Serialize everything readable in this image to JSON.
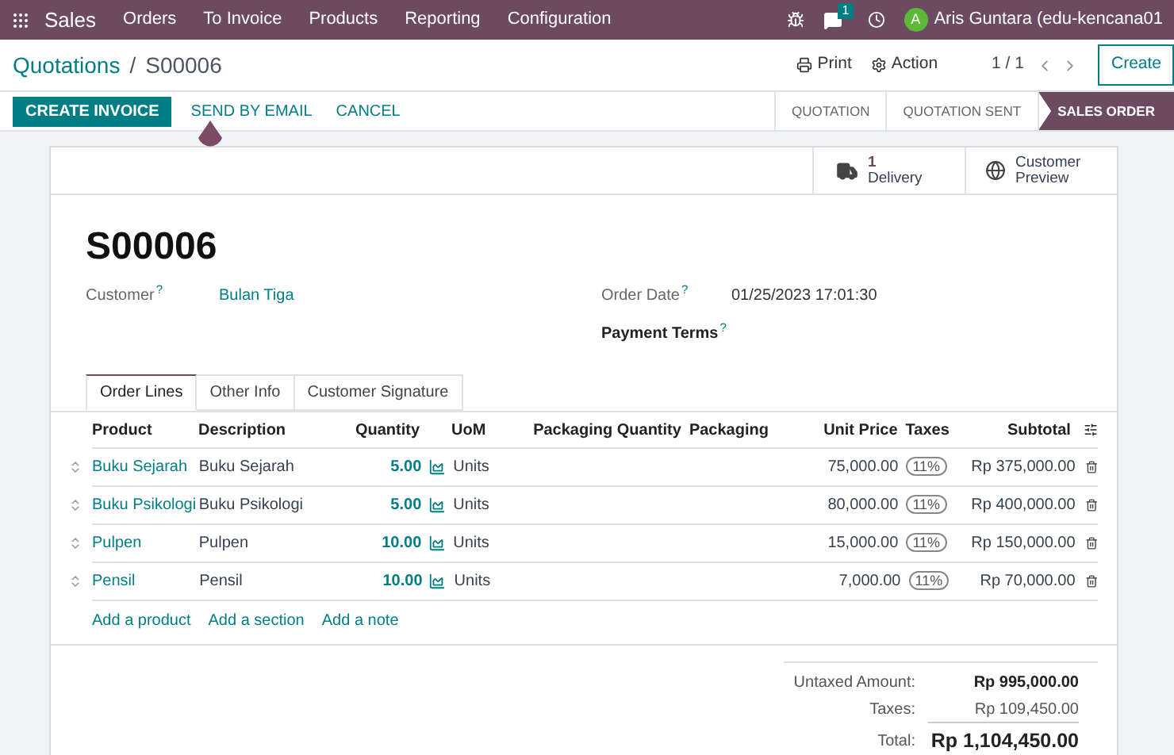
{
  "navbar": {
    "app": "Sales",
    "menu": [
      "Orders",
      "To Invoice",
      "Products",
      "Reporting",
      "Configuration"
    ],
    "messages_badge": "1",
    "user_initial": "A",
    "user_name": "Aris Guntara (edu-kencana01"
  },
  "breadcrumb": {
    "parent": "Quotations",
    "separator": "/",
    "current": "S00006"
  },
  "toolbar": {
    "print": "Print",
    "action": "Action",
    "pager": "1 / 1",
    "create": "Create"
  },
  "actions": [
    {
      "label": "CREATE INVOICE",
      "kind": "primary"
    },
    {
      "label": "SEND BY EMAIL",
      "kind": "link"
    },
    {
      "label": "CANCEL",
      "kind": "link"
    }
  ],
  "stages": [
    {
      "label": "QUOTATION",
      "selected": false
    },
    {
      "label": "QUOTATION SENT",
      "selected": false
    },
    {
      "label": "SALES ORDER",
      "selected": true
    }
  ],
  "smart_buttons": [
    {
      "kind": "delivery",
      "count": "1",
      "label": "Delivery"
    },
    {
      "kind": "preview",
      "line1": "Customer",
      "line2": "Preview"
    }
  ],
  "record": {
    "name": "S00006",
    "customer_label": "Customer",
    "customer": "Bulan Tiga",
    "order_date_label": "Order Date",
    "order_date": "01/25/2023 17:01:30",
    "payment_terms_label": "Payment Terms",
    "help_mark": "?"
  },
  "tabs": [
    {
      "label": "Order Lines",
      "selected": true
    },
    {
      "label": "Other Info",
      "selected": false
    },
    {
      "label": "Customer Signature",
      "selected": false
    }
  ],
  "table": {
    "columns": [
      "Product",
      "Description",
      "Quantity",
      "UoM",
      "Packaging Quantity",
      "Packaging",
      "Unit Price",
      "Taxes",
      "Subtotal"
    ],
    "rows": [
      {
        "product": "Buku Sejarah",
        "description": "Buku Sejarah",
        "quantity": "5.00",
        "uom": "Units",
        "unit_price": "75,000.00",
        "tax": "11%",
        "subtotal": "Rp 375,000.00"
      },
      {
        "product": "Buku Psikologi",
        "description": "Buku Psikologi",
        "quantity": "5.00",
        "uom": "Units",
        "unit_price": "80,000.00",
        "tax": "11%",
        "subtotal": "Rp 400,000.00"
      },
      {
        "product": "Pulpen",
        "description": "Pulpen",
        "quantity": "10.00",
        "uom": "Units",
        "unit_price": "15,000.00",
        "tax": "11%",
        "subtotal": "Rp 150,000.00"
      },
      {
        "product": "Pensil",
        "description": "Pensil",
        "quantity": "10.00",
        "uom": "Units",
        "unit_price": "7,000.00",
        "tax": "11%",
        "subtotal": "Rp 70,000.00"
      }
    ],
    "add_links": [
      "Add a product",
      "Add a section",
      "Add a note"
    ]
  },
  "totals": {
    "untaxed_label": "Untaxed Amount:",
    "untaxed": "Rp 995,000.00",
    "taxes_label": "Taxes:",
    "taxes": "Rp 109,450.00",
    "total_label": "Total:",
    "total": "Rp 1,104,450.00"
  }
}
